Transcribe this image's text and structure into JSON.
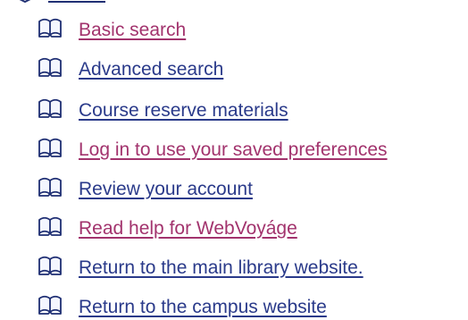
{
  "menu": {
    "items": [
      {
        "label": "Basic search",
        "state": "visited",
        "icon": "open-book-icon"
      },
      {
        "label": "Advanced search",
        "state": "unvisited",
        "icon": "open-book-icon"
      },
      {
        "label": "Course reserve materials",
        "state": "unvisited",
        "icon": "open-book-icon"
      },
      {
        "label": "Log in to use your saved preferences",
        "state": "visited",
        "icon": "open-book-icon"
      },
      {
        "label": "Review your account",
        "state": "unvisited",
        "icon": "open-book-icon"
      },
      {
        "label": "Read help for WebVoyáge",
        "state": "visited",
        "icon": "open-book-icon"
      },
      {
        "label": "Return to the main library website.",
        "state": "unvisited",
        "icon": "open-book-icon"
      },
      {
        "label": "Return to the campus website",
        "state": "unvisited",
        "icon": "open-book-icon"
      }
    ]
  },
  "colors": {
    "link_unvisited": "#2a3a8a",
    "link_visited": "#a2336d",
    "icon_stroke": "#1f2f73",
    "background": "#ffffff"
  }
}
